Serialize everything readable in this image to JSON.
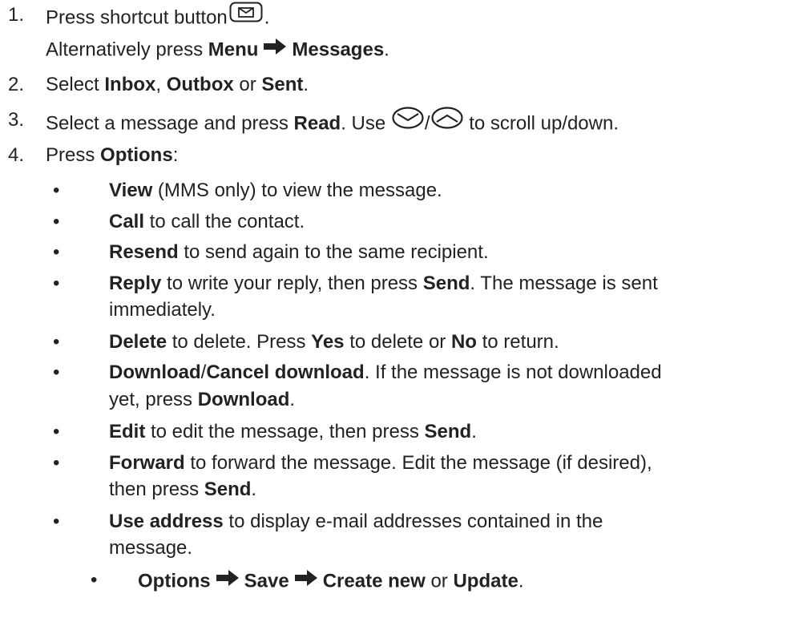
{
  "steps": [
    {
      "num": "1.",
      "text_a": "Press shortcut button",
      "text_b": ".",
      "alt_a": "Alternatively press",
      "alt_menu": "Menu",
      "alt_messages": "Messages",
      "alt_end": "."
    },
    {
      "num": "2.",
      "a": "Select",
      "inbox": "Inbox",
      "sep1": ",",
      "outbox": "Outbox",
      "or": "or",
      "sent": "Sent",
      "end": "."
    },
    {
      "num": "3.",
      "a": "Select a message and press",
      "read": "Read",
      "b": ". Use",
      "slash": "/",
      "c": "to scroll up/down."
    },
    {
      "num": "4.",
      "a": "Press",
      "options": "Options",
      "end": ":"
    }
  ],
  "bullets": [
    {
      "label": "View",
      "rest": " (MMS only) to view the message."
    },
    {
      "label": "Call",
      "rest": " to call the contact."
    },
    {
      "label": "Resend",
      "rest": " to send again to the same recipient."
    },
    {
      "label": "Reply",
      "rest": " to write your reply, then press ",
      "label2": "Send",
      "rest2": ". The message is sent",
      "cont": "immediately."
    },
    {
      "label": "Delete",
      "rest": " to delete. Press ",
      "yes": "Yes",
      "rest2": " to delete or ",
      "no": "No",
      "rest3": " to return."
    },
    {
      "label": "Download",
      "slash": "/",
      "label2": "Cancel download",
      "rest": ". If the message is not downloaded",
      "cont_a": "yet, press ",
      "cont_label": "Download",
      "cont_end": "."
    },
    {
      "label": "Edit",
      "rest": " to edit the message, then press ",
      "label2": "Send",
      "end": "."
    },
    {
      "label": "Forward",
      "rest": " to forward the message. Edit the message (if desired),",
      "cont_a": "then press ",
      "cont_label": "Send",
      "cont_end": "."
    },
    {
      "label": "Use address",
      "rest": " to display e-mail addresses contained in the",
      "cont": "message."
    }
  ],
  "sub_bullet": {
    "options": "Options",
    "save": "Save",
    "create_new": "Create new",
    "or": "or",
    "update": "Update",
    "end": "."
  },
  "bullet_char": "•",
  "icons": {
    "message_key": "envelope-key-icon",
    "scroll_down": "scroll-down-icon",
    "scroll_up": "scroll-up-icon",
    "arrow": "right-arrow-icon"
  }
}
